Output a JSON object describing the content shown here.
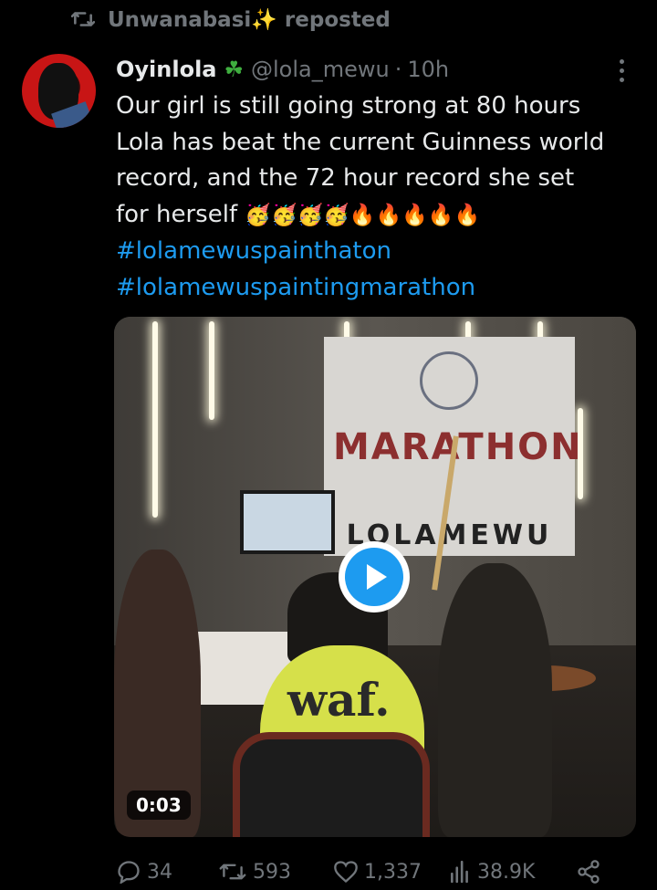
{
  "repost": {
    "label": "Unwanabasi✨ reposted"
  },
  "post": {
    "name": "Oyinlola",
    "badge": "☘",
    "handle": "@lola_mewu",
    "time": "10h",
    "text_lines": [
      "Our girl is still going strong at 80 hours",
      "Lola has beat the current Guinness world",
      "record, and the 72 hour record she set"
    ],
    "text_last": "for herself",
    "emojis": "🥳🥳🥳🥳🔥🔥🔥🔥🔥",
    "hashtags": [
      "#lolamewuspainthaton",
      "#lolamewuspaintingmarathon"
    ]
  },
  "media": {
    "duration": "0:03",
    "banner_title": "MARATHON",
    "banner_subtitle": "LOLAMEWU",
    "shirt_text": "waf."
  },
  "actions": {
    "replies": "34",
    "reposts": "593",
    "likes": "1,337",
    "views": "38.9K"
  },
  "colors": {
    "accent": "#1d9bf0",
    "muted": "#71767b",
    "text": "#e7e9ea",
    "background": "#000000"
  }
}
